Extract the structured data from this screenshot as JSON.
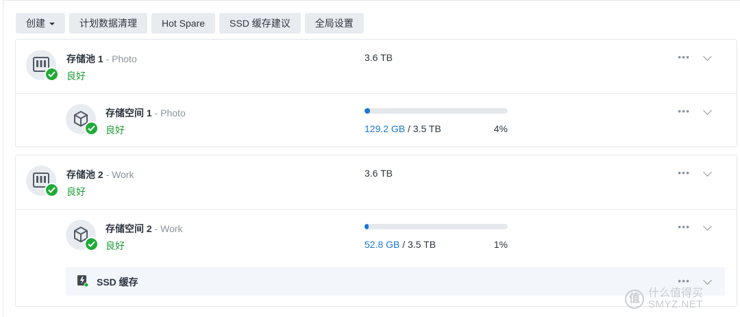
{
  "toolbar": {
    "create_label": "创建",
    "scrub_label": "计划数据清理",
    "hotspare_label": "Hot Spare",
    "ssd_advice_label": "SSD 缓存建议",
    "global_settings_label": "全局设置"
  },
  "pools": [
    {
      "name": "存储池 1",
      "sub": "Photo",
      "status": "良好",
      "capacity": "3.6 TB",
      "volume": {
        "name": "存储空间 1",
        "sub": "Photo",
        "status": "良好",
        "used": "129.2 GB",
        "total": "3.5 TB",
        "percent_label": "4%",
        "percent": 4
      }
    },
    {
      "name": "存储池 2",
      "sub": "Work",
      "status": "良好",
      "capacity": "3.6 TB",
      "volume": {
        "name": "存储空间 2",
        "sub": "Work",
        "status": "良好",
        "used": "52.8 GB",
        "total": "3.5 TB",
        "percent_label": "1%",
        "percent": 1
      },
      "ssd_cache_label": "SSD 缓存"
    }
  ],
  "common": {
    "more": "•••",
    "separator": " - ",
    "slash": " / "
  },
  "watermark": {
    "logo": "值",
    "text": "什么值得买",
    "url": "SMYZ.NET"
  },
  "colors": {
    "status_ok": "#1e9d35",
    "accent": "#1877d2",
    "badge": "#1fab38"
  },
  "icons": {
    "pool": "nas-pool-icon",
    "volume": "volume-cube-icon",
    "status_ok": "check-circle-icon",
    "ssd": "ssd-cache-icon",
    "more": "more-dots-icon",
    "expand": "chevron-down-icon"
  }
}
